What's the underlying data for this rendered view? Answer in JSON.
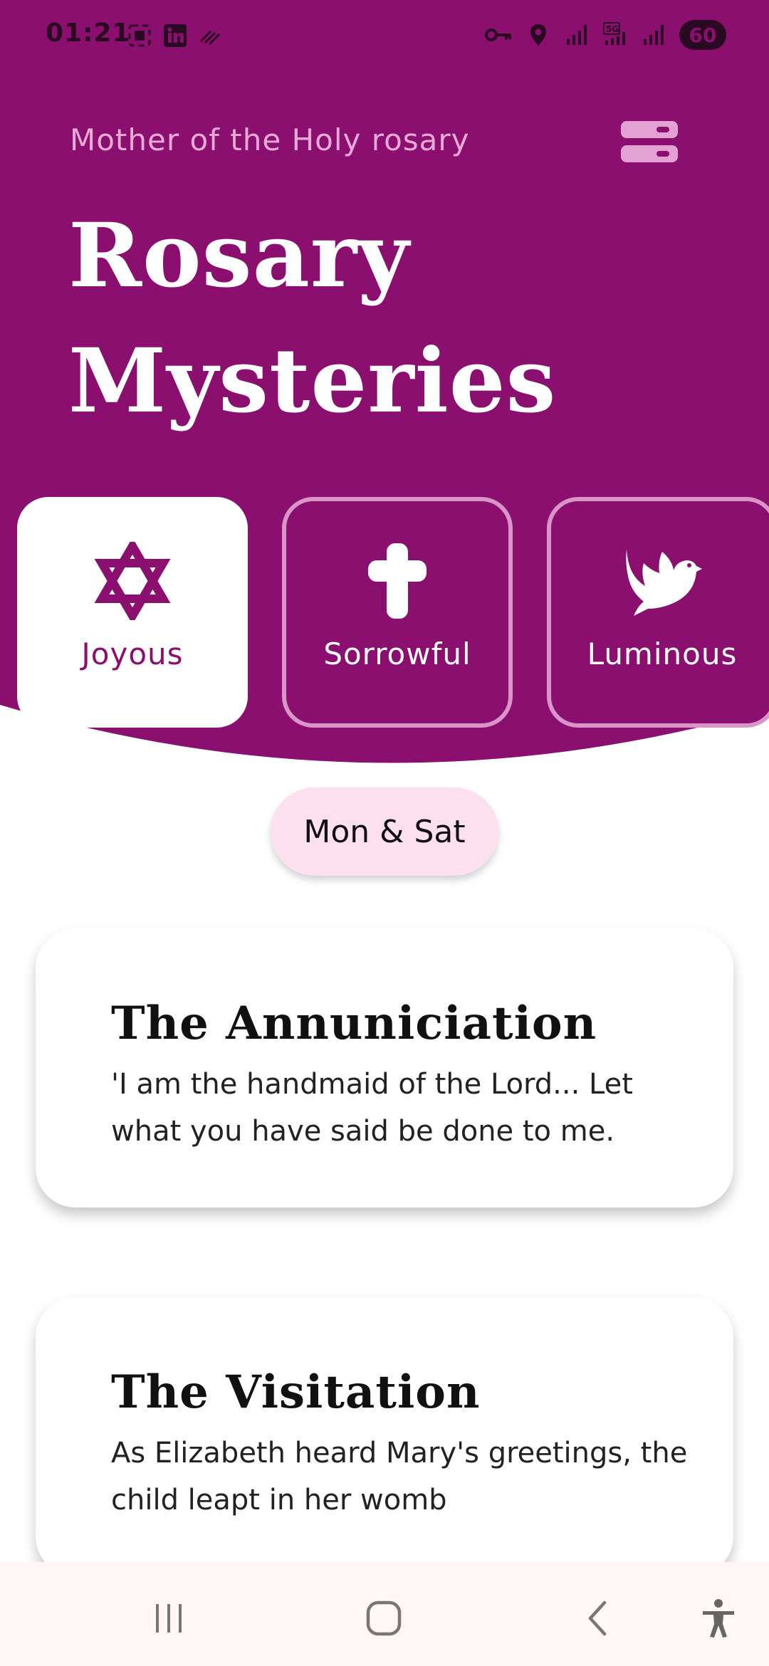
{
  "status_bar": {
    "time": "01:21",
    "battery": "60",
    "left_icons": [
      "screenshot-icon",
      "linkedin-icon",
      "data-icon"
    ],
    "right_icons": [
      "vpn-key-icon",
      "location-icon",
      "signal-icon",
      "5g-signal-icon",
      "signal-icon"
    ]
  },
  "header": {
    "subtitle": "Mother of the Holy rosary",
    "title_line1": "Rosary",
    "title_line2": "Mysteries",
    "menu_icon": "menu-icon"
  },
  "colors": {
    "primary": "#8a0f6e",
    "accent_light": "#e4a2d4",
    "chip_bg": "#fde0ee",
    "white": "#ffffff"
  },
  "mysteries": [
    {
      "label": "Joyous",
      "icon": "star-of-david-icon",
      "active": true
    },
    {
      "label": "Sorrowful",
      "icon": "cross-icon",
      "active": false
    },
    {
      "label": "Luminous",
      "icon": "dove-icon",
      "active": false
    }
  ],
  "days_chip": "Mon & Sat",
  "cards": [
    {
      "title": "The Annuniciation",
      "text": "'I am the handmaid of the Lord... Let what you have said be done to me."
    },
    {
      "title": "The Visitation",
      "text": "As Elizabeth heard Mary's greetings, the child leapt in her womb"
    }
  ],
  "nav_bar": {
    "icons": [
      "recent-apps-icon",
      "home-icon",
      "back-icon",
      "accessibility-icon"
    ]
  }
}
